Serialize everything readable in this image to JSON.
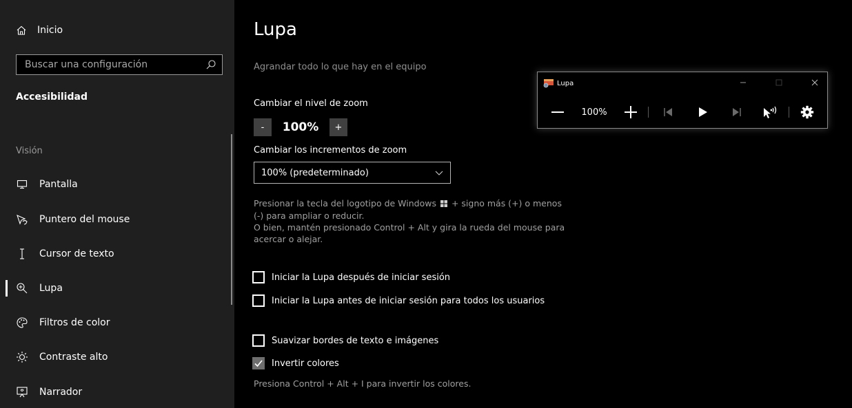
{
  "sidebar": {
    "home_label": "Inicio",
    "search_placeholder": "Buscar una configuración",
    "category_title": "Accesibilidad",
    "group_title": "Visión",
    "items": [
      {
        "label": "Pantalla",
        "icon": "monitor-icon"
      },
      {
        "label": "Puntero del mouse",
        "icon": "pointer-icon"
      },
      {
        "label": "Cursor de texto",
        "icon": "text-cursor-icon"
      },
      {
        "label": "Lupa",
        "icon": "magnifier-icon",
        "selected": true
      },
      {
        "label": "Filtros de color",
        "icon": "palette-icon"
      },
      {
        "label": "Contraste alto",
        "icon": "sun-icon"
      },
      {
        "label": "Narrador",
        "icon": "narrator-icon"
      }
    ]
  },
  "main": {
    "title": "Lupa",
    "subtitle": "Agrandar todo lo que hay en el equipo",
    "zoom_level_label": "Cambiar el nivel de zoom",
    "zoom_minus": "-",
    "zoom_value": "100%",
    "zoom_plus": "+",
    "increments_label": "Cambiar los incrementos de zoom",
    "increments_value": "100% (predeterminado)",
    "desc_line1": "Presionar la tecla del logotipo de Windows",
    "desc_line1b": "+ signo más (+) o menos",
    "desc_line2": "(-) para ampliar o reducir.",
    "desc_line3": "O bien, mantén presionado Control + Alt y gira la rueda del mouse para",
    "desc_line4": "acercar o alejar.",
    "check_start_after_login": {
      "label": "Iniciar la Lupa después de iniciar sesión",
      "checked": false
    },
    "check_start_before_login": {
      "label": "Iniciar la Lupa antes de iniciar sesión para todos los usuarios",
      "checked": false
    },
    "check_smooth_edges": {
      "label": "Suavizar bordes de texto e imágenes",
      "checked": false
    },
    "check_invert": {
      "label": "Invertir colores",
      "checked": true
    },
    "invert_hint": "Presiona Control + Alt + I para invertir los colores."
  },
  "magnifier_window": {
    "title": "Lupa",
    "zoom_value": "100%"
  },
  "colors": {
    "sidebar_bg": "#1f1f1f",
    "main_bg": "#000000",
    "muted_text": "#a0a0a0",
    "button_bg": "#404040"
  }
}
